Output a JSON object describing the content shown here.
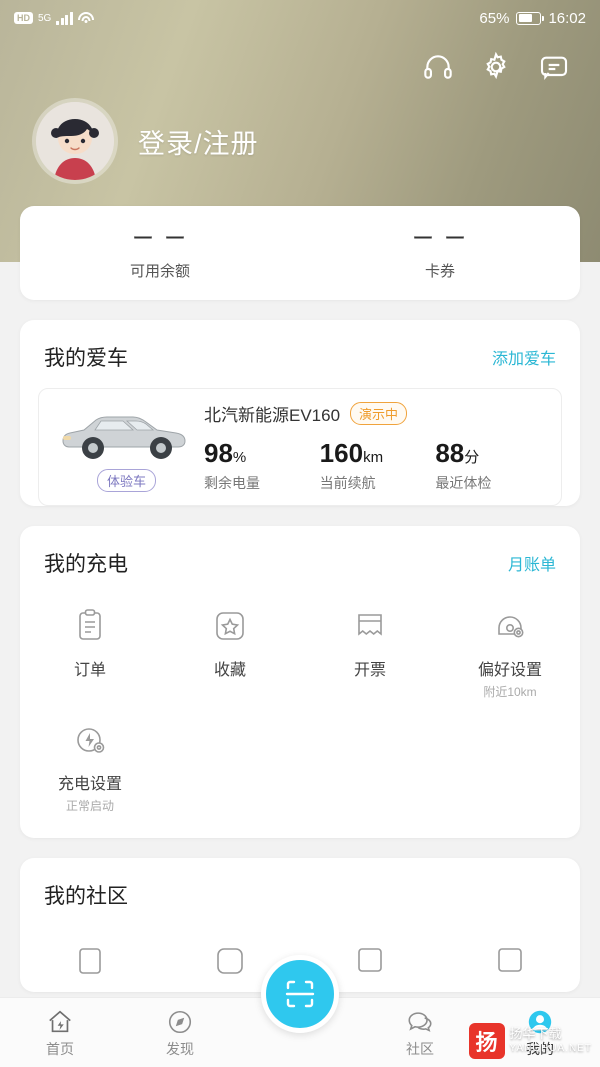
{
  "status_bar": {
    "hd_label": "HD",
    "network": "5G",
    "battery_percent": "65%",
    "time": "16:02"
  },
  "header": {
    "icons": [
      "headset-icon",
      "gear-icon",
      "message-icon"
    ],
    "login_text": "登录/注册",
    "avatar": "user-avatar"
  },
  "balance": {
    "items": [
      {
        "value": "ー ー",
        "label": "可用余额"
      },
      {
        "value": "ー ー",
        "label": "卡券"
      }
    ]
  },
  "my_car": {
    "title": "我的爱车",
    "link": "添加爱车",
    "car_tag": "体验车",
    "car_name": "北汽新能源EV160",
    "demo_tag": "演示中",
    "stats": [
      {
        "value": "98",
        "unit": "%",
        "label": "剩余电量"
      },
      {
        "value": "160",
        "unit": "km",
        "label": "当前续航"
      },
      {
        "value": "88",
        "unit": "分",
        "label": "最近体检"
      }
    ]
  },
  "my_charging": {
    "title": "我的充电",
    "link": "月账单",
    "items": [
      {
        "icon": "order-icon",
        "label": "订单",
        "sub": ""
      },
      {
        "icon": "star-icon",
        "label": "收藏",
        "sub": ""
      },
      {
        "icon": "invoice-icon",
        "label": "开票",
        "sub": ""
      },
      {
        "icon": "preference-icon",
        "label": "偏好设置",
        "sub": "附近10km"
      },
      {
        "icon": "charge-setting-icon",
        "label": "充电设置",
        "sub": "正常启动"
      }
    ]
  },
  "my_community": {
    "title": "我的社区",
    "items": [
      {
        "icon": "item1-icon",
        "label": ""
      },
      {
        "icon": "item2-icon",
        "label": ""
      },
      {
        "icon": "item3-icon",
        "label": ""
      },
      {
        "icon": "item4-icon",
        "label": ""
      }
    ]
  },
  "bottom_nav": {
    "items": [
      {
        "icon": "home-icon",
        "label": "首页",
        "active": false
      },
      {
        "icon": "compass-icon",
        "label": "发现",
        "active": false
      },
      {
        "icon": "scan-icon",
        "label": "",
        "active": false
      },
      {
        "icon": "community-icon",
        "label": "社区",
        "active": false
      },
      {
        "icon": "profile-icon",
        "label": "我的",
        "active": true
      }
    ],
    "scan_label": "scan-button"
  },
  "watermark": {
    "logo": "扬",
    "line1": "扬华下载",
    "line2": "YANGHUA.NET"
  },
  "colors": {
    "accent": "#2fc8ee",
    "link": "#2bb7d4",
    "tag_purple": "#7d78c0",
    "tag_orange": "#ef9c2c"
  }
}
